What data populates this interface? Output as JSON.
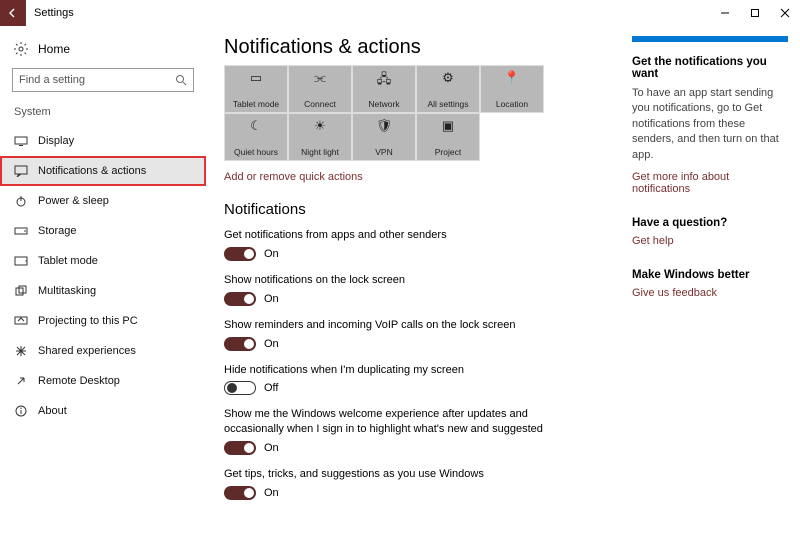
{
  "window": {
    "title": "Settings"
  },
  "sidebar": {
    "home": "Home",
    "searchPlaceholder": "Find a setting",
    "sectionLabel": "System",
    "items": [
      {
        "label": "Display"
      },
      {
        "label": "Notifications & actions"
      },
      {
        "label": "Power & sleep"
      },
      {
        "label": "Storage"
      },
      {
        "label": "Tablet mode"
      },
      {
        "label": "Multitasking"
      },
      {
        "label": "Projecting to this PC"
      },
      {
        "label": "Shared experiences"
      },
      {
        "label": "Remote Desktop"
      },
      {
        "label": "About"
      }
    ]
  },
  "main": {
    "heading": "Notifications & actions",
    "quickActions": [
      {
        "label": "Tablet mode"
      },
      {
        "label": "Connect"
      },
      {
        "label": "Network"
      },
      {
        "label": "All settings"
      },
      {
        "label": "Location"
      },
      {
        "label": "Quiet hours"
      },
      {
        "label": "Night light"
      },
      {
        "label": "VPN"
      },
      {
        "label": "Project"
      }
    ],
    "addRemoveLink": "Add or remove quick actions",
    "notificationsHeading": "Notifications",
    "settings": [
      {
        "label": "Get notifications from apps and other senders",
        "state": "On",
        "on": true
      },
      {
        "label": "Show notifications on the lock screen",
        "state": "On",
        "on": true
      },
      {
        "label": "Show reminders and incoming VoIP calls on the lock screen",
        "state": "On",
        "on": true
      },
      {
        "label": "Hide notifications when I'm duplicating my screen",
        "state": "Off",
        "on": false
      },
      {
        "label": "Show me the Windows welcome experience after updates and occasionally when I sign in to highlight what's new and suggested",
        "state": "On",
        "on": true
      },
      {
        "label": "Get tips, tricks, and suggestions as you use Windows",
        "state": "On",
        "on": true
      }
    ]
  },
  "right": {
    "notifHeading": "Get the notifications you want",
    "notifBody": "To have an app start sending you notifications, go to Get notifications from these senders, and then turn on that app.",
    "notifLink": "Get more info about notifications",
    "questionHeading": "Have a question?",
    "questionLink": "Get help",
    "betterHeading": "Make Windows better",
    "betterLink": "Give us feedback"
  }
}
